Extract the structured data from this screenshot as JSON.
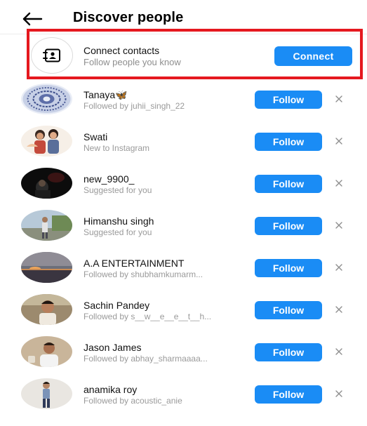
{
  "header": {
    "title": "Discover people",
    "back_icon": "arrow-left-icon"
  },
  "connect": {
    "icon": "contact-card-icon",
    "title": "Connect contacts",
    "subtitle": "Follow people you know",
    "button_label": "Connect",
    "highlight_color": "#e5181f"
  },
  "colors": {
    "accent": "#1a8cf5",
    "secondary_text": "#8e8e8e"
  },
  "suggestions": [
    {
      "name": "Tanaya🦋",
      "subtitle": "Followed by juhii_singh_22",
      "follow_label": "Follow",
      "avatar": "mandala"
    },
    {
      "name": "Swati",
      "subtitle": "New to Instagram",
      "follow_label": "Follow",
      "avatar": "couple-illustration"
    },
    {
      "name": "new_9900_",
      "subtitle": "Suggested for you",
      "follow_label": "Follow",
      "avatar": "dark-photo"
    },
    {
      "name": "Himanshu singh",
      "subtitle": "Suggested for you",
      "follow_label": "Follow",
      "avatar": "outdoor-photo"
    },
    {
      "name": "A.A ENTERTAINMENT",
      "subtitle": "Followed by shubhamkumarm...",
      "follow_label": "Follow",
      "avatar": "sunset-photo"
    },
    {
      "name": "Sachin Pandey",
      "subtitle": "Followed by s__w__e__e__t__h...",
      "follow_label": "Follow",
      "avatar": "man-portrait"
    },
    {
      "name": "Jason James",
      "subtitle": "Followed by abhay_sharmaaaa...",
      "follow_label": "Follow",
      "avatar": "man-white-shirt"
    },
    {
      "name": "anamika roy",
      "subtitle": "Followed by acoustic_anie",
      "follow_label": "Follow",
      "avatar": "woman-standing"
    }
  ]
}
